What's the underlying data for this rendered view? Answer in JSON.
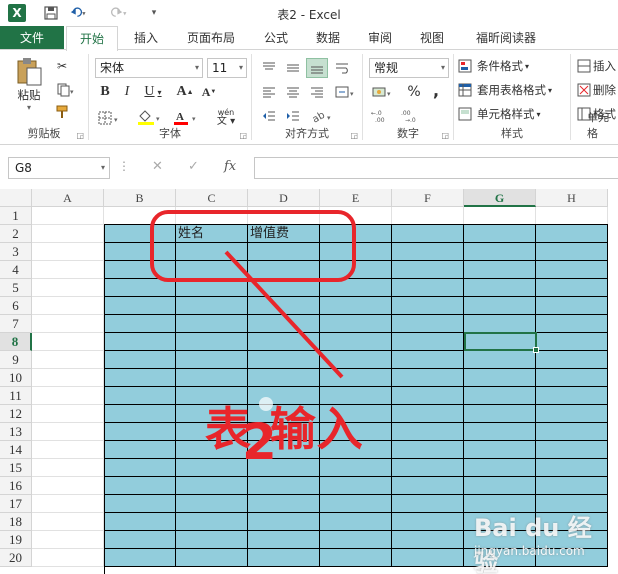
{
  "titlebar": {
    "app_logo": "X",
    "title": "表2 - Excel",
    "icons": [
      "excel-logo-icon",
      "save-icon",
      "undo-icon",
      "redo-icon",
      "customize-quick-access-icon"
    ]
  },
  "tabs": {
    "file": "文件",
    "items": [
      "开始",
      "插入",
      "页面布局",
      "公式",
      "数据",
      "审阅",
      "视图",
      "福昕阅读器"
    ],
    "active": "开始"
  },
  "ribbon": {
    "clipboard": {
      "label": "剪贴板",
      "paste": "粘贴"
    },
    "font": {
      "label": "字体",
      "font_name": "宋体",
      "font_size": "11",
      "wen": "wén"
    },
    "alignment": {
      "label": "对齐方式"
    },
    "number": {
      "label": "数字",
      "format": "常规",
      "percent": "%",
      "comma": ","
    },
    "styles": {
      "label": "样式",
      "conditional": "条件格式",
      "table_format": "套用表格格式",
      "cell_styles": "单元格样式"
    },
    "cells": {
      "label": "单元格",
      "insert": "插入",
      "delete": "删除",
      "format": "格式"
    }
  },
  "formula_bar": {
    "name_box": "G8",
    "fx": "fx",
    "value": ""
  },
  "grid": {
    "columns": [
      "A",
      "B",
      "C",
      "D",
      "E",
      "F",
      "G",
      "H"
    ],
    "selected_column": "G",
    "rows": [
      "1",
      "2",
      "3",
      "4",
      "5",
      "6",
      "7",
      "8",
      "9",
      "10",
      "11",
      "12",
      "13",
      "14",
      "15",
      "16",
      "17",
      "18",
      "19",
      "20"
    ],
    "selected_row": "8",
    "cells": {
      "C2": "姓名",
      "D2": "增值费"
    },
    "fill_color": "#92cddc",
    "accent_color": "#217346"
  },
  "annotation": {
    "text_a": "表",
    "text_num": "2",
    "text_b": "输入",
    "color": "#e8262b"
  },
  "watermark": {
    "logo": "Bai du 经验",
    "url": "jingyan.baidu.com"
  }
}
